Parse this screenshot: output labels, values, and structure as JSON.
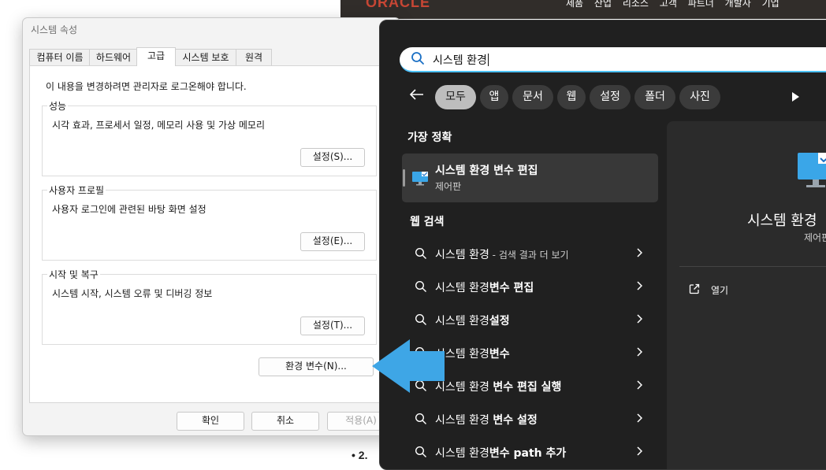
{
  "background": {
    "oracle_logo": "ORACLE",
    "nav": [
      "제품",
      "산업",
      "리소스",
      "고객",
      "파트너",
      "개발자",
      "기업"
    ],
    "bullet": "• 2."
  },
  "dialog": {
    "title": "시스템 속성",
    "tabs": [
      "컴퓨터 이름",
      "하드웨어",
      "고급",
      "시스템 보호",
      "원격"
    ],
    "active_tab": "고급",
    "admin_note": "이 내용을 변경하려면 관리자로 로그온해야 합니다.",
    "groups": [
      {
        "title": "성능",
        "desc": "시각 효과, 프로세서 일정, 메모리 사용 및 가상 메모리",
        "button": "설정(S)..."
      },
      {
        "title": "사용자 프로필",
        "desc": "사용자 로그인에 관련된 바탕 화면 설정",
        "button": "설정(E)..."
      },
      {
        "title": "시작 및 복구",
        "desc": "시스템 시작, 시스템 오류 및 디버깅 정보",
        "button": "설정(T)..."
      }
    ],
    "env_button": "환경 변수(N)...",
    "ok": "확인",
    "cancel": "취소",
    "apply": "적용(A)"
  },
  "search": {
    "query": "시스템 환경",
    "filters": [
      "모두",
      "앱",
      "문서",
      "웹",
      "설정",
      "폴더",
      "사진"
    ],
    "active_filter": "모두",
    "best_match_heading": "가장 정확",
    "best_match": {
      "title": "시스템 환경 변수 편집",
      "subtitle": "제어판"
    },
    "web_heading": "웹 검색",
    "web_results": [
      {
        "normal": "시스템 환경",
        "bold": "",
        "suffix": " - 검색 결과 더 보기"
      },
      {
        "normal": "시스템 환경",
        "bold": "변수 편집",
        "suffix": ""
      },
      {
        "normal": "시스템 환경",
        "bold": "설정",
        "suffix": ""
      },
      {
        "normal": "시스템 환경",
        "bold": "변수",
        "suffix": ""
      },
      {
        "normal": "시스템 환경 ",
        "bold": "변수 편집 실행",
        "suffix": ""
      },
      {
        "normal": "시스템 환경 ",
        "bold": "변수 설정",
        "suffix": ""
      },
      {
        "normal": "시스템 환경",
        "bold": "변수 path 추가",
        "suffix": ""
      }
    ],
    "preview": {
      "title": "시스템 환경",
      "subtitle": "제어판",
      "open_label": "열기"
    }
  },
  "colors": {
    "accent": "#4cc2ff",
    "arrow": "#3ea6e6",
    "oracle_red": "#c74634"
  },
  "icons": [
    "search-icon",
    "back-arrow-icon",
    "play-icon",
    "monitor-icon",
    "chevron-right-icon",
    "open-external-icon",
    "blue-pointer-arrow"
  ]
}
